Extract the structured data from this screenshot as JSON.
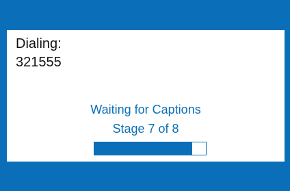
{
  "dialing": {
    "label": "Dialing:",
    "number": "321555"
  },
  "status": {
    "message": "Waiting for Captions",
    "stage": "Stage 7 of 8"
  },
  "progress": {
    "fraction": 0.875
  },
  "colors": {
    "accent": "#0a6fb8",
    "background": "#ffffff",
    "text": "#111111"
  }
}
